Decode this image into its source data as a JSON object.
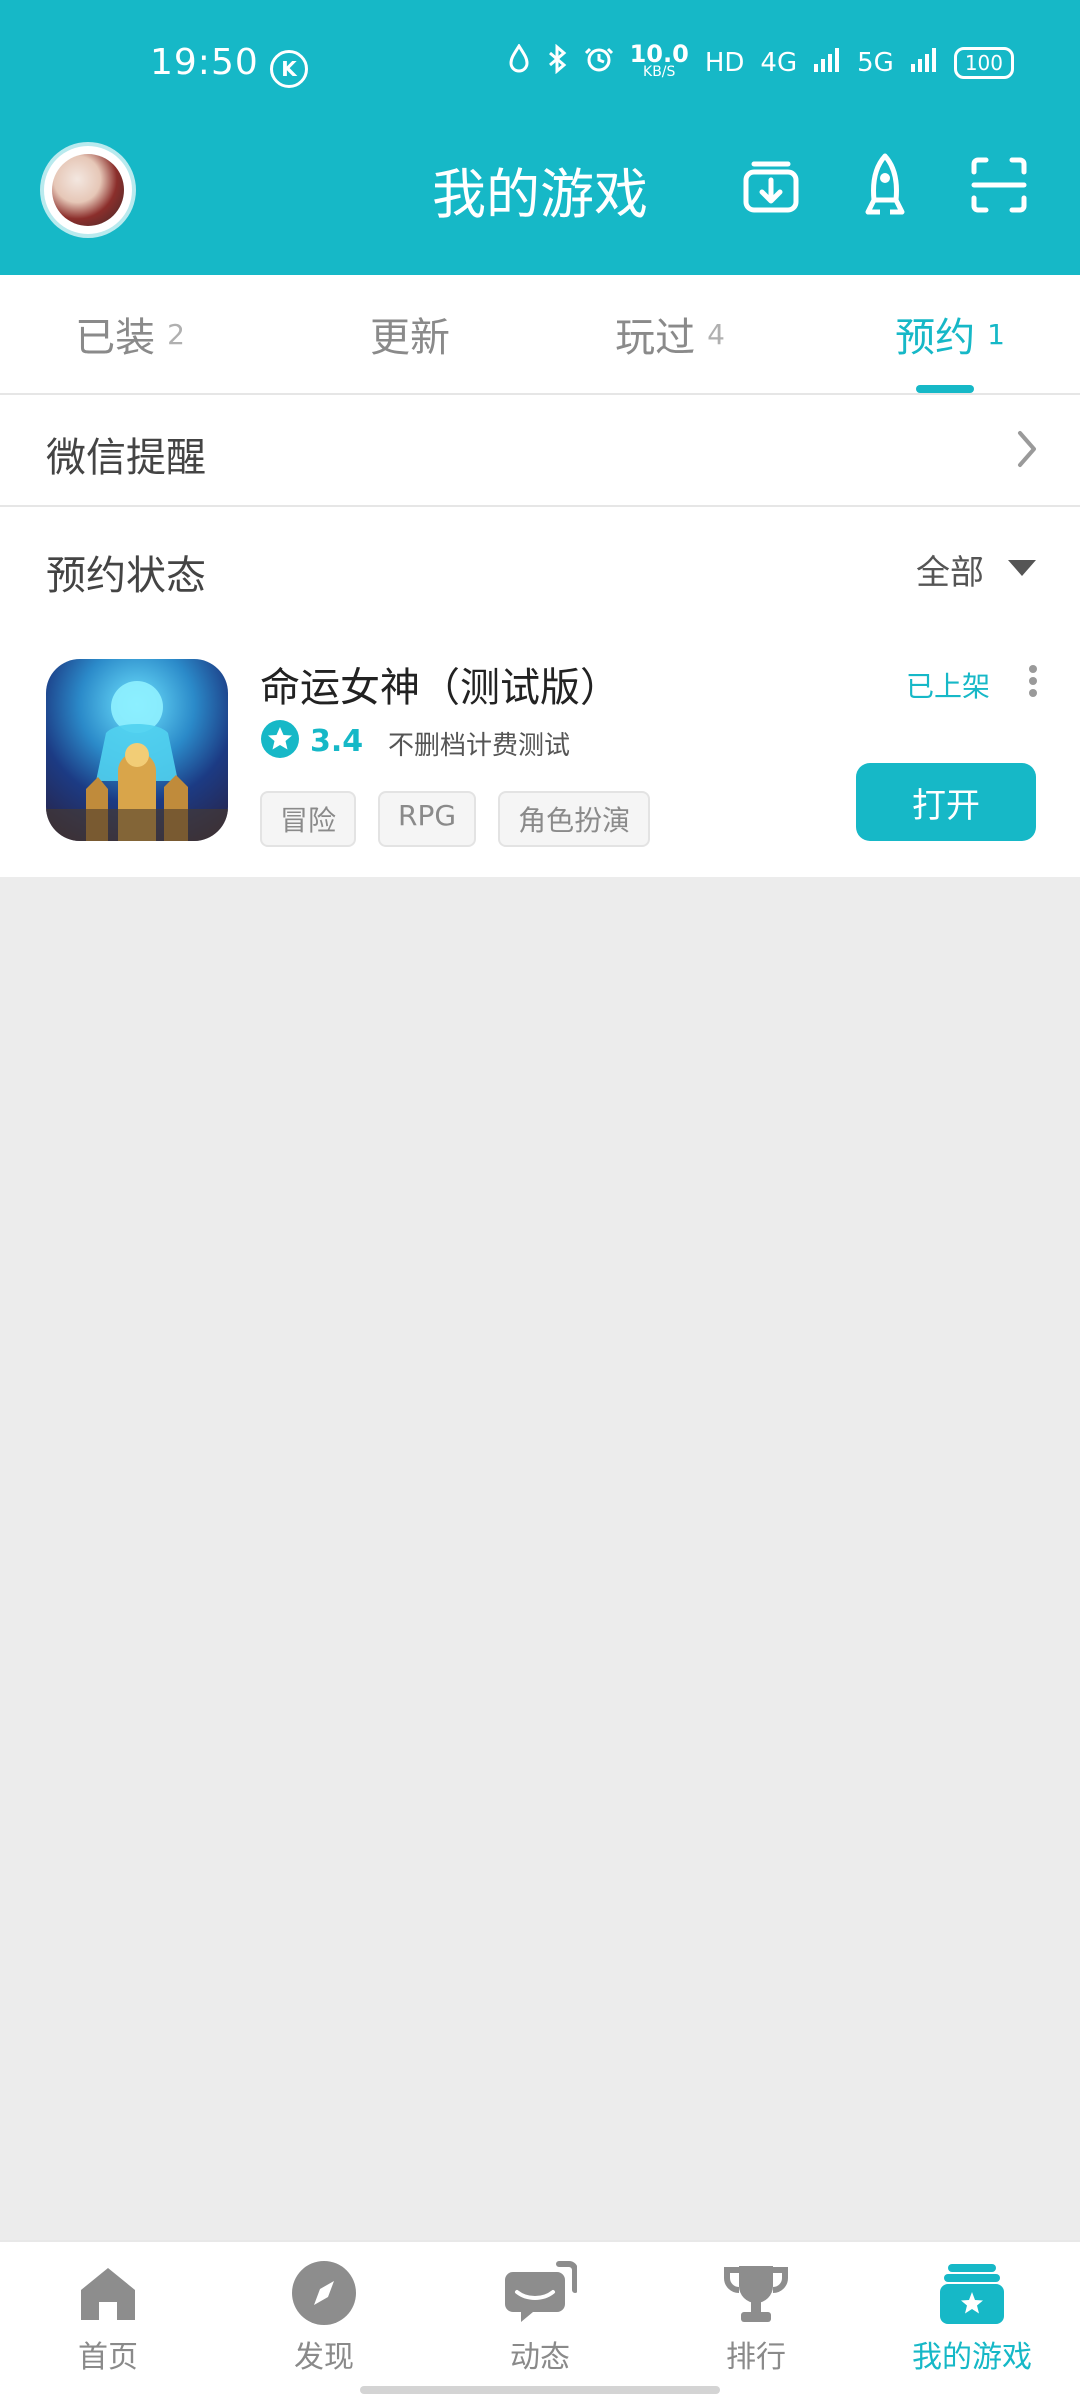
{
  "status_bar": {
    "time": "19:50",
    "k_label": "K",
    "net_speed_value": "10.0",
    "net_speed_unit": "KB/S",
    "hd": "HD",
    "signal1": "4G",
    "signal2": "5G",
    "battery": "100"
  },
  "header": {
    "title": "我的游戏"
  },
  "tabs": [
    {
      "label": "已装",
      "count": "2"
    },
    {
      "label": "更新",
      "count": ""
    },
    {
      "label": "玩过",
      "count": "4"
    },
    {
      "label": "预约",
      "count": "1"
    }
  ],
  "wechat": {
    "label": "微信提醒"
  },
  "reservation": {
    "status_label": "预约状态",
    "filter": "全部"
  },
  "game": {
    "name": "命运女神（测试版）",
    "rating": "3.4",
    "subtitle": "不删档计费测试",
    "status": "已上架",
    "open_label": "打开",
    "tags": [
      "冒险",
      "RPG",
      "角色扮演"
    ]
  },
  "bottom_nav": [
    {
      "label": "首页"
    },
    {
      "label": "发现"
    },
    {
      "label": "动态"
    },
    {
      "label": "排行"
    },
    {
      "label": "我的游戏"
    }
  ],
  "colors": {
    "primary": "#16b8c7",
    "background": "#ececec"
  }
}
